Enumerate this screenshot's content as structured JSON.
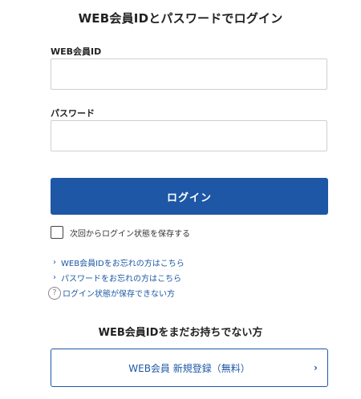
{
  "login": {
    "title": "WEB会員IDとパスワードでログイン",
    "id_label": "WEB会員ID",
    "id_value": "",
    "id_placeholder": "",
    "password_label": "パスワード",
    "password_value": "",
    "password_placeholder": "",
    "submit_label": "ログイン",
    "remember_label": "次回からログイン状態を保存する"
  },
  "links": {
    "forgot_id": "WEB会員IDをお忘れの方はこちら",
    "forgot_password": "パスワードをお忘れの方はこちら",
    "cannot_save": "ログイン状態が保存できない方"
  },
  "icons": {
    "link_chevron": "chevron-right-icon",
    "help": "question-circle-icon",
    "register_chevron": "chevron-right-icon"
  },
  "register": {
    "heading": "WEB会員IDをまだお持ちでない方",
    "button_label": "WEB会員 新規登録（無料）"
  },
  "colors": {
    "accent": "#1d57a6",
    "text": "#222222",
    "border": "#cfcfcf"
  }
}
